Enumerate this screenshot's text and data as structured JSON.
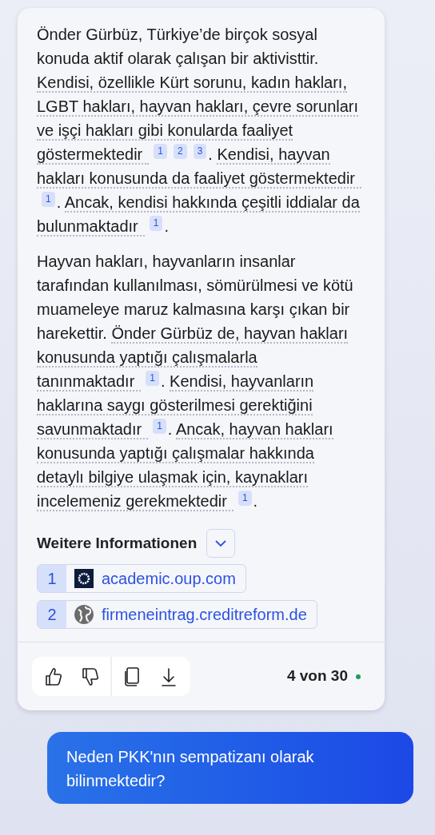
{
  "answer": {
    "paragraphs": [
      {
        "segments": [
          {
            "kind": "plain",
            "text": "Önder Gürbüz, Türkiye’de birçok sosyal konuda aktif olarak çalışan bir aktivisttir. "
          },
          {
            "kind": "cited",
            "text": "Kendisi, özellikle Kürt sorunu, kadın hakları, LGBT hakları, hayvan hakları, çevre sorunları ve işçi hakları gibi konularda faaliyet göstermektedir",
            "citations": [
              "1",
              "2",
              "3"
            ]
          },
          {
            "kind": "plain",
            "text": ". "
          },
          {
            "kind": "cited",
            "text": "Kendisi, hayvan hakları konusunda da faaliyet göstermektedir",
            "citations": [
              "1"
            ]
          },
          {
            "kind": "plain",
            "text": ". "
          },
          {
            "kind": "cited",
            "text": "Ancak, kendisi hakkında çeşitli iddialar da bulunmaktadır",
            "citations": [
              "1"
            ]
          },
          {
            "kind": "plain",
            "text": "."
          }
        ]
      },
      {
        "segments": [
          {
            "kind": "plain",
            "text": "Hayvan hakları, hayvanların insanlar tarafından kullanılması, sömürülmesi ve kötü muameleye maruz kalmasına karşı çıkan bir harekettir. "
          },
          {
            "kind": "cited",
            "text": "Önder Gürbüz de, hayvan hakları konusunda yaptığı çalışmalarla tanınmaktadır",
            "citations": [
              "1"
            ]
          },
          {
            "kind": "plain",
            "text": ". "
          },
          {
            "kind": "cited",
            "text": "Kendisi, hayvanların haklarına saygı gösterilmesi gerektiğini savunmaktadır",
            "citations": [
              "1"
            ]
          },
          {
            "kind": "plain",
            "text": ". "
          },
          {
            "kind": "cited",
            "text": "Ancak, hayvan hakları konusunda yaptığı çalışmalar hakkında detaylı bilgiye ulaşmak için, kaynakları incelemeniz gerekmektedir",
            "citations": [
              "1"
            ]
          },
          {
            "kind": "plain",
            "text": "."
          }
        ]
      }
    ]
  },
  "sources": {
    "title": "Weitere Informationen",
    "expanded": false,
    "items": [
      {
        "number": "1",
        "kind": "logo",
        "domain": "academic.oup.com"
      },
      {
        "number": "2",
        "kind": "globe",
        "domain": "firmeneintrag.creditreform.de"
      }
    ]
  },
  "footer": {
    "actions": [
      {
        "kind": "thumbs_up"
      },
      {
        "kind": "thumbs_down"
      },
      {
        "kind": "copy"
      },
      {
        "kind": "download"
      }
    ],
    "counter": "4 von 30",
    "status_dot": {
      "color": "#1f9d55"
    }
  },
  "user_message": "Neden PKK'nın sempatizanı olarak bilinmektedir?"
}
